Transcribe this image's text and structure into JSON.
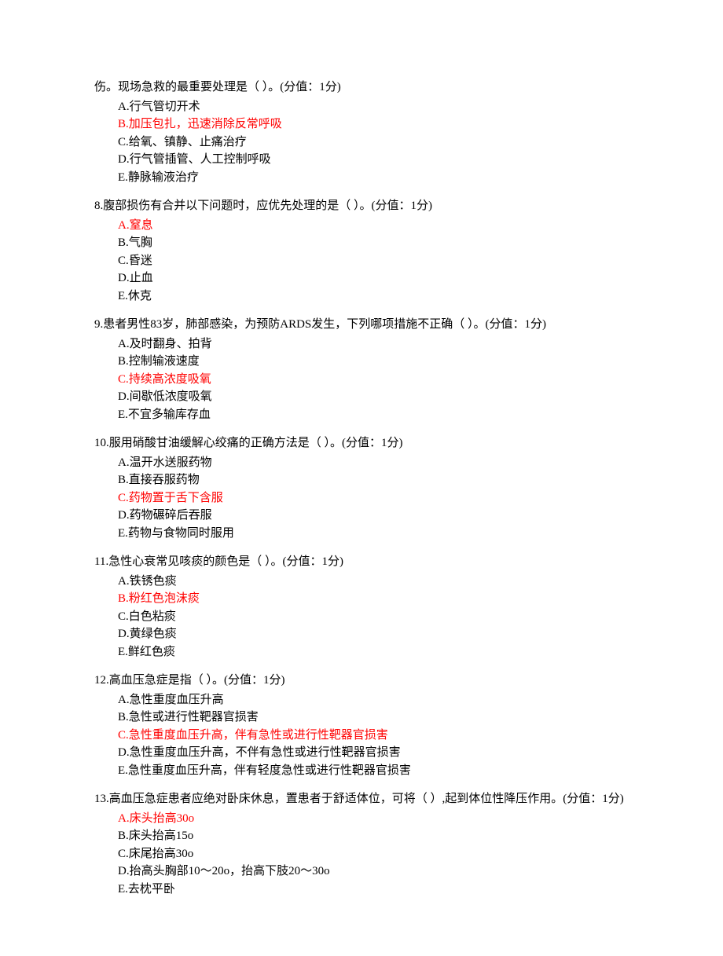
{
  "questions": [
    {
      "stem": "伤。现场急救的最重要处理是（ ）。(分值：1分)",
      "options": [
        {
          "text": "A.行气管切开术",
          "correct": false
        },
        {
          "text": "B.加压包扎，迅速消除反常呼吸",
          "correct": true
        },
        {
          "text": "C.给氧、镇静、止痛治疗",
          "correct": false
        },
        {
          "text": "D.行气管插管、人工控制呼吸",
          "correct": false
        },
        {
          "text": "E.静脉输液治疗",
          "correct": false
        }
      ]
    },
    {
      "stem": "8.腹部损伤有合并以下问题时，应优先处理的是（ ）。(分值：1分)",
      "options": [
        {
          "text": "A.窒息",
          "correct": true
        },
        {
          "text": "B.气胸",
          "correct": false
        },
        {
          "text": "C.昏迷",
          "correct": false
        },
        {
          "text": "D.止血",
          "correct": false
        },
        {
          "text": "E.休克",
          "correct": false
        }
      ]
    },
    {
      "stem": "9.患者男性83岁，肺部感染，为预防ARDS发生，下列哪项措施不正确（ ）。(分值：1分)",
      "options": [
        {
          "text": "A.及时翻身、拍背",
          "correct": false
        },
        {
          "text": "B.控制输液速度",
          "correct": false
        },
        {
          "text": "C.持续高浓度吸氧",
          "correct": true
        },
        {
          "text": "D.间歇低浓度吸氧",
          "correct": false
        },
        {
          "text": "E.不宜多输库存血",
          "correct": false
        }
      ]
    },
    {
      "stem": "10.服用硝酸甘油缓解心绞痛的正确方法是（ ）。(分值：1分)",
      "options": [
        {
          "text": "A.温开水送服药物",
          "correct": false
        },
        {
          "text": "B.直接吞服药物",
          "correct": false
        },
        {
          "text": "C.药物置于舌下含服",
          "correct": true
        },
        {
          "text": "D.药物碾碎后吞服",
          "correct": false
        },
        {
          "text": "E.药物与食物同时服用",
          "correct": false
        }
      ]
    },
    {
      "stem": "11.急性心衰常见咳痰的颜色是（ ）。(分值：1分)",
      "options": [
        {
          "text": "A.铁锈色痰",
          "correct": false
        },
        {
          "text": "B.粉红色泡沫痰",
          "correct": true
        },
        {
          "text": "C.白色粘痰",
          "correct": false
        },
        {
          "text": "D.黄绿色痰",
          "correct": false
        },
        {
          "text": "E.鲜红色痰",
          "correct": false
        }
      ]
    },
    {
      "stem": "12.高血压急症是指（ ）。(分值：1分)",
      "options": [
        {
          "text": "A.急性重度血压升高",
          "correct": false
        },
        {
          "text": "B.急性或进行性靶器官损害",
          "correct": false
        },
        {
          "text": "C.急性重度血压升高，伴有急性或进行性靶器官损害",
          "correct": true
        },
        {
          "text": "D.急性重度血压升高，不伴有急性或进行性靶器官损害",
          "correct": false
        },
        {
          "text": "E.急性重度血压升高，伴有轻度急性或进行性靶器官损害",
          "correct": false
        }
      ]
    },
    {
      "stem": "13.高血压急症患者应绝对卧床休息，置患者于舒适体位，可将（ ）,起到体位性降压作用。(分值：1分)",
      "options": [
        {
          "text": "A.床头抬高30o",
          "correct": true
        },
        {
          "text": "B.床头抬高15o",
          "correct": false
        },
        {
          "text": "C.床尾抬高30o",
          "correct": false
        },
        {
          "text": "D.抬高头胸部10～20o，抬高下肢20～30o",
          "correct": false
        },
        {
          "text": "E.去枕平卧",
          "correct": false
        }
      ]
    }
  ]
}
